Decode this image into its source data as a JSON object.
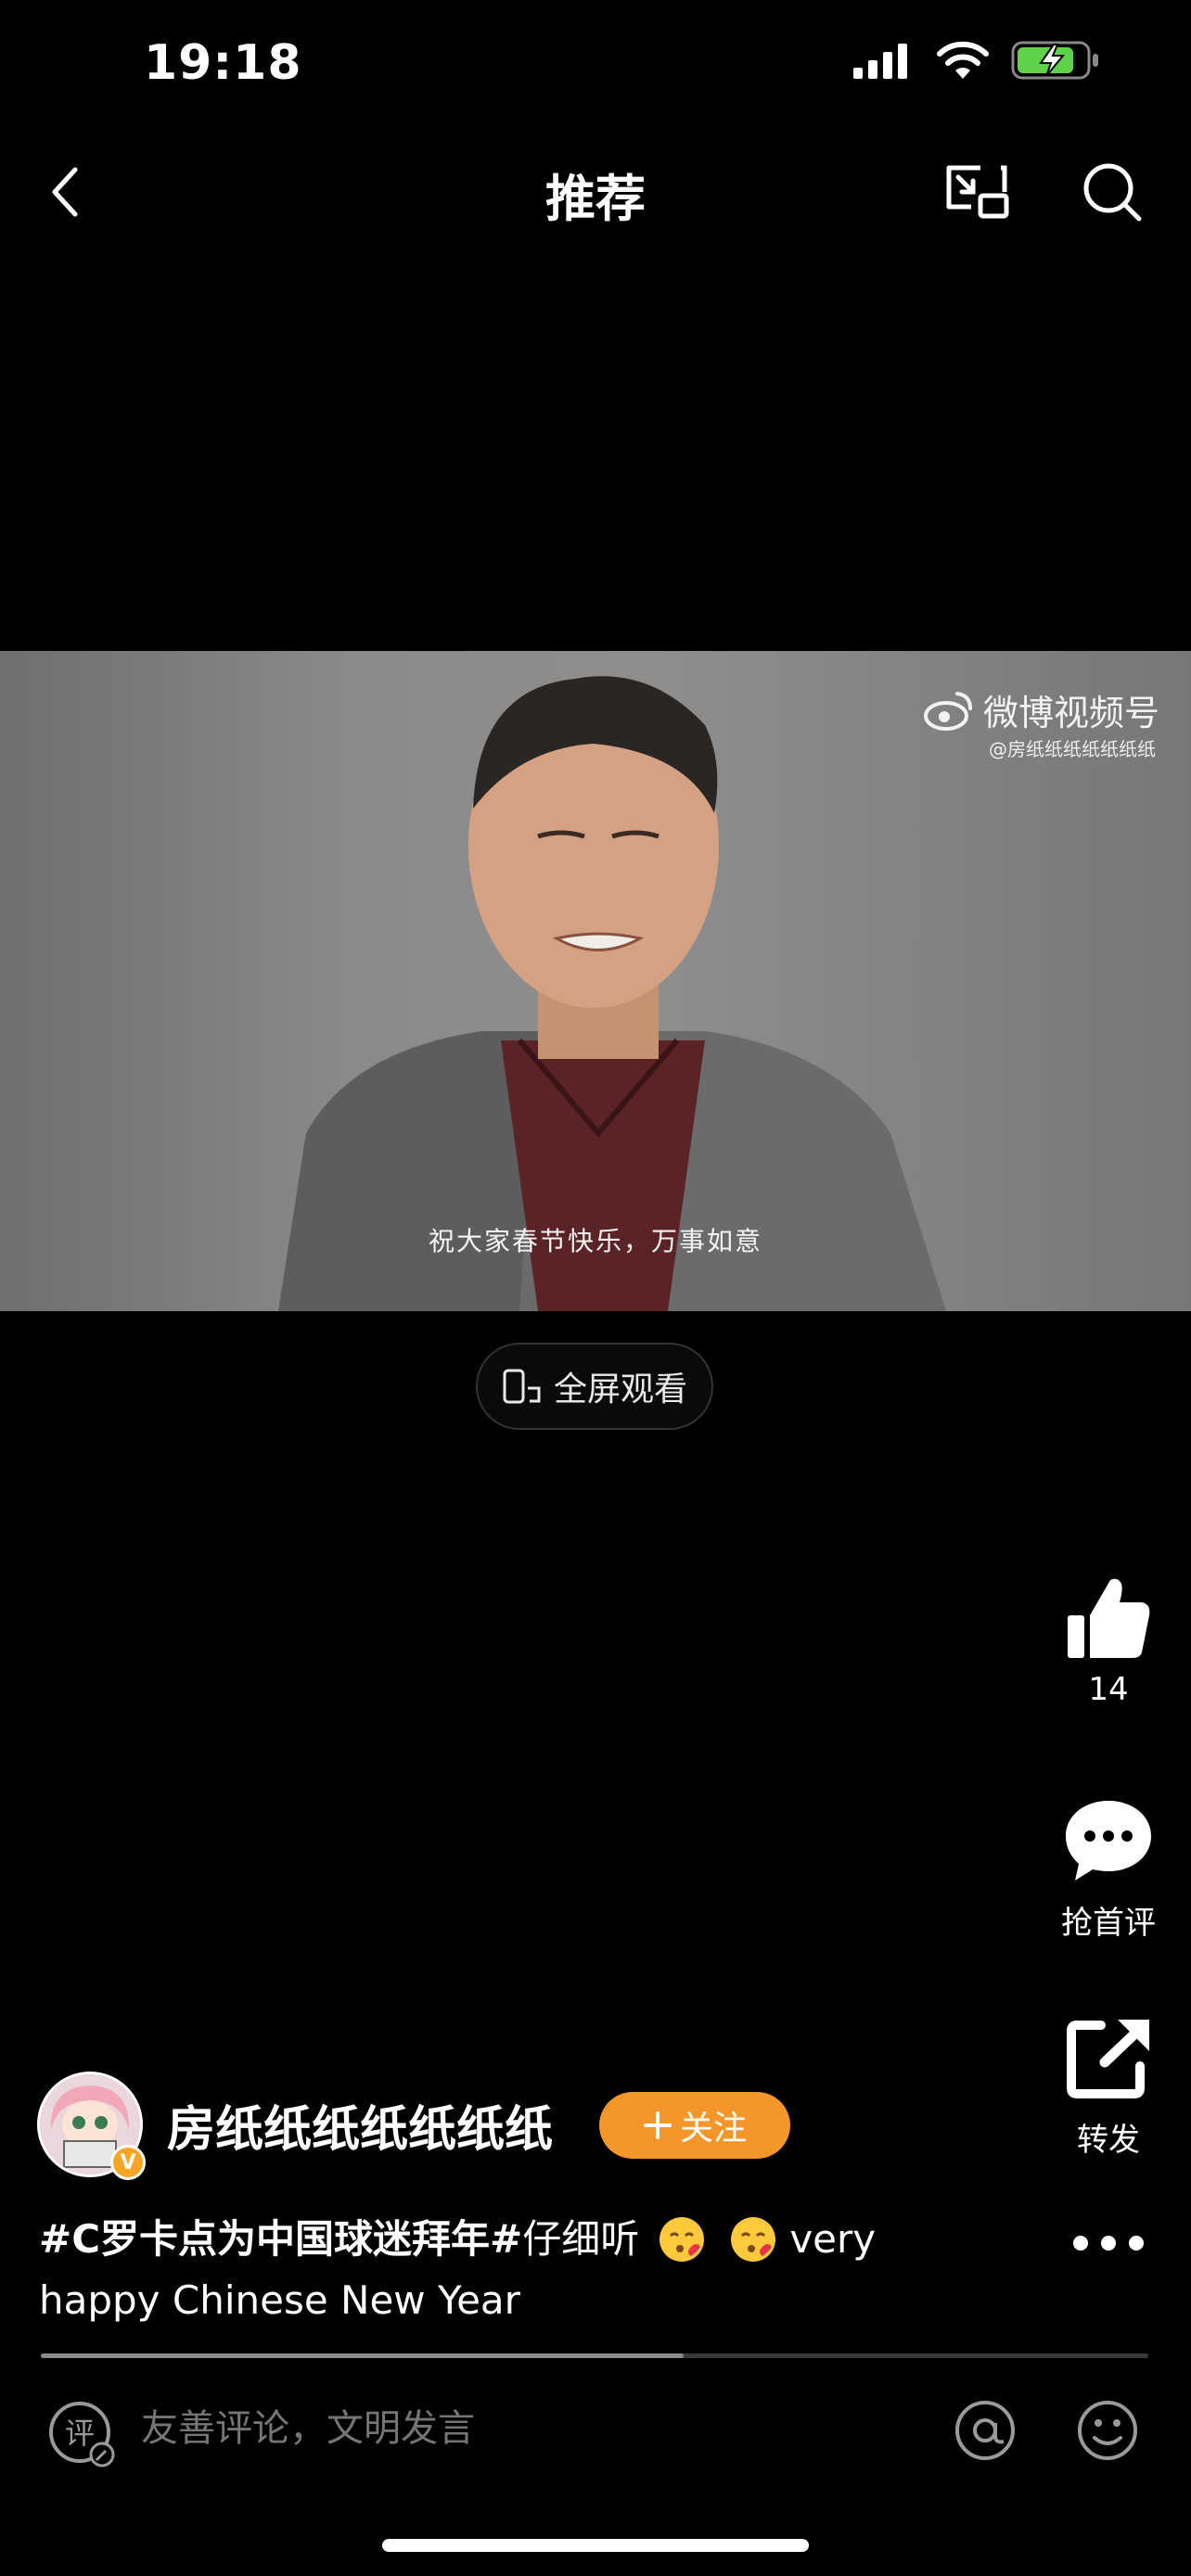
{
  "status_bar": {
    "time": "19:18",
    "signal_icon": "cellular-signal-icon",
    "wifi_icon": "wifi-icon",
    "battery_icon": "battery-charging-icon",
    "battery_color": "#5ed34a"
  },
  "header": {
    "title": "推荐",
    "back_icon": "chevron-left-icon",
    "pip_icon": "picture-in-picture-icon",
    "search_icon": "search-icon"
  },
  "video": {
    "watermark": "微博视频号",
    "watermark_handle": "@房纸纸纸纸纸纸纸",
    "subtitle": "祝大家春节快乐，万事如意"
  },
  "fullscreen": {
    "label": "全屏观看",
    "icon": "phone-rotate-icon"
  },
  "actions": [
    {
      "icon": "thumbs-up-icon",
      "label": "14"
    },
    {
      "icon": "comment-bubble-icon",
      "label": "抢首评"
    },
    {
      "icon": "share-icon",
      "label": "转发"
    },
    {
      "icon": "more-dots-icon",
      "label": ""
    }
  ],
  "author": {
    "name": "房纸纸纸纸纸纸纸",
    "follow_label": "关注",
    "verified_badge": "V",
    "accent": "#f5962b"
  },
  "caption": {
    "hashtag": "#C罗卡点为中国球迷拜年#",
    "text": "仔细听",
    "tail_line1": "very",
    "tail_line2": "happy Chinese New Year"
  },
  "progress": {
    "fraction": 0.58
  },
  "comment_bar": {
    "placeholder": "友善评论，文明发言",
    "comment_icon": "comment-edit-icon",
    "at_icon": "at-mention-icon",
    "emoji_icon": "emoji-icon"
  }
}
